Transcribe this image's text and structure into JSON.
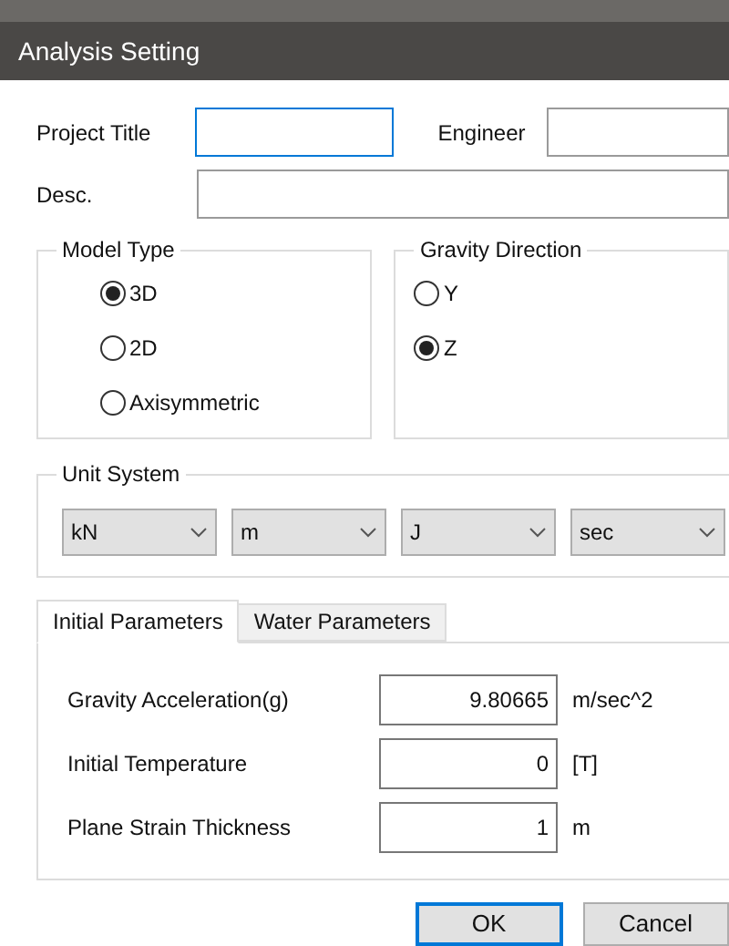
{
  "window": {
    "title": "Analysis Setting"
  },
  "fields": [
    {
      "label": "Project Title",
      "focused": true
    },
    {
      "label": "Engineer",
      "focused": false
    },
    {
      "label": "Desc.",
      "focused": false
    }
  ],
  "model_type": {
    "title": "Model Type",
    "options": [
      {
        "label": "3D",
        "selected": true
      },
      {
        "label": "2D",
        "selected": false
      },
      {
        "label": "Axisymmetric",
        "selected": false
      }
    ]
  },
  "gravity_direction": {
    "title": "Gravity Direction",
    "options": [
      {
        "label": "Y",
        "selected": false
      },
      {
        "label": "Z",
        "selected": true
      }
    ]
  },
  "unit_system": {
    "title": "Unit System",
    "units": [
      "kN",
      "m",
      "J",
      "sec"
    ]
  },
  "tabs": [
    {
      "label": "Initial Parameters",
      "selected": true
    },
    {
      "label": "Water Parameters",
      "selected": false
    }
  ],
  "parameters": [
    {
      "label": "Gravity Acceleration(g)",
      "value": "9.80665",
      "unit": "m/sec^2"
    },
    {
      "label": "Initial Temperature",
      "value": "0",
      "unit": "[T]"
    },
    {
      "label": "Plane Strain Thickness",
      "value": "1",
      "unit": "m"
    }
  ],
  "buttons": [
    {
      "label": "OK",
      "default": true
    },
    {
      "label": "Cancel",
      "default": false
    }
  ]
}
